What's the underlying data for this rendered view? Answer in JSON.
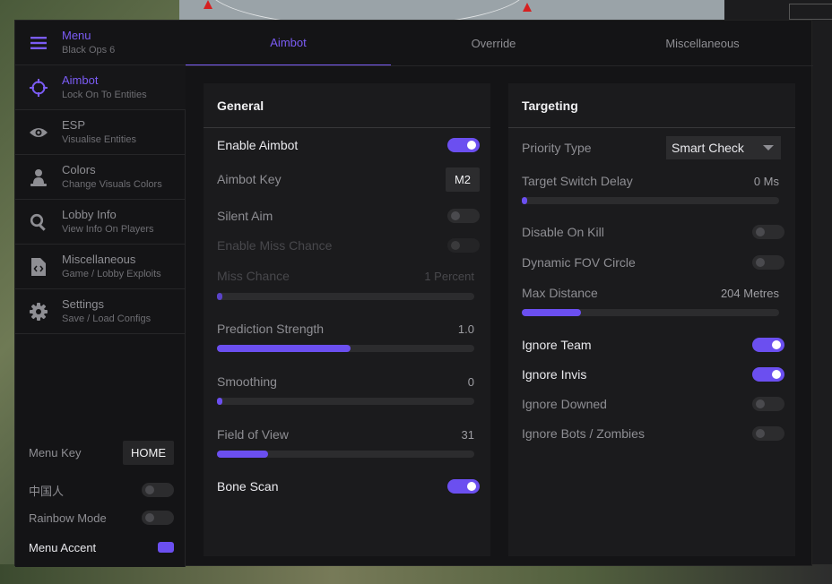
{
  "sidebar": {
    "items": [
      {
        "title": "Menu",
        "subtitle": "Black Ops 6",
        "icon": "hamburger-icon"
      },
      {
        "title": "Aimbot",
        "subtitle": "Lock On To Entities",
        "icon": "crosshair-icon"
      },
      {
        "title": "ESP",
        "subtitle": "Visualise Entities",
        "icon": "eye-icon"
      },
      {
        "title": "Colors",
        "subtitle": "Change Visuals Colors",
        "icon": "person-icon"
      },
      {
        "title": "Lobby Info",
        "subtitle": "View Info On Players",
        "icon": "search-icon"
      },
      {
        "title": "Miscellaneous",
        "subtitle": "Game / Lobby Exploits",
        "icon": "file-code-icon"
      },
      {
        "title": "Settings",
        "subtitle": "Save / Load Configs",
        "icon": "gear-icon"
      }
    ],
    "menu_key_label": "Menu Key",
    "menu_key_value": "HOME",
    "chinese_label": "中国人",
    "rainbow_label": "Rainbow Mode",
    "accent_label": "Menu Accent",
    "accent_color": "#6b4ff0"
  },
  "tabs": [
    "Aimbot",
    "Override",
    "Miscellaneous"
  ],
  "general": {
    "title": "General",
    "enable_aimbot": "Enable Aimbot",
    "aimbot_key": "Aimbot Key",
    "aimbot_key_value": "M2",
    "silent_aim": "Silent Aim",
    "enable_miss_chance": "Enable Miss Chance",
    "miss_chance": "Miss Chance",
    "miss_chance_value": "1 Percent",
    "prediction_strength": "Prediction Strength",
    "prediction_strength_value": "1.0",
    "smoothing": "Smoothing",
    "smoothing_value": "0",
    "field_of_view": "Field of View",
    "field_of_view_value": "31",
    "bone_scan": "Bone Scan"
  },
  "targeting": {
    "title": "Targeting",
    "priority_type": "Priority Type",
    "priority_type_value": "Smart Check",
    "target_switch_delay": "Target Switch Delay",
    "target_switch_delay_value": "0 Ms",
    "disable_on_kill": "Disable On Kill",
    "dynamic_fov_circle": "Dynamic FOV Circle",
    "max_distance": "Max Distance",
    "max_distance_value": "204 Metres",
    "ignore_team": "Ignore Team",
    "ignore_invis": "Ignore Invis",
    "ignore_downed": "Ignore Downed",
    "ignore_bots": "Ignore Bots / Zombies"
  },
  "levels": {
    "miss_chance_fill": 0.02,
    "prediction_fill": 0.52,
    "smoothing_fill": 0.02,
    "fov_fill": 0.2,
    "switch_delay_fill": 0.02,
    "max_distance_fill": 0.23
  },
  "toggles": {
    "enable_aimbot": true,
    "silent_aim": false,
    "enable_miss_chance": false,
    "bone_scan": true,
    "disable_on_kill": false,
    "dynamic_fov_circle": false,
    "ignore_team": true,
    "ignore_invis": true,
    "ignore_downed": false,
    "ignore_bots": false,
    "chinese": false,
    "rainbow_mode": false
  }
}
